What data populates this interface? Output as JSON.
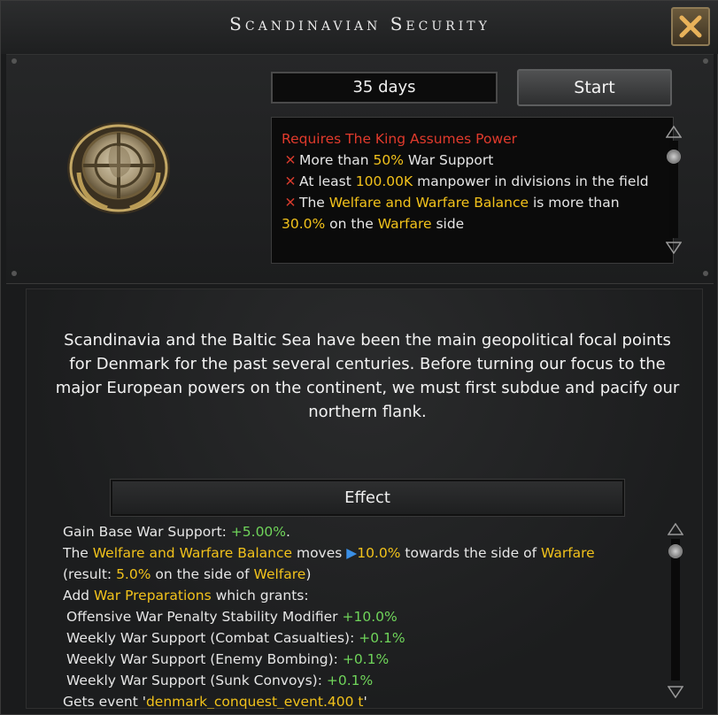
{
  "window": {
    "title": "Scandinavian Security",
    "close_icon": "close-x-icon"
  },
  "focus": {
    "icon": "crosshair-emblem-icon",
    "duration": "35 days",
    "start_label": "Start"
  },
  "requirements": {
    "header": "Requires The King Assumes Power",
    "lines": [
      {
        "pre": "More than ",
        "hl": "50%",
        "post": " War Support"
      },
      {
        "pre": "At least ",
        "hl": "100.00K",
        "post": " manpower in divisions in the field"
      },
      {
        "pre": "The ",
        "hl": "Welfare and Warfare Balance",
        "post": " is more than ",
        "hl2": "30.0%",
        "post2": " on the ",
        "hl3": "Warfare",
        "post3": " side"
      }
    ]
  },
  "description": "Scandinavia and the Baltic Sea have been the main geopolitical focal points for Denmark for the past several centuries. Before turning our focus to the major European powers on the continent, we must first subdue and pacify our northern flank.",
  "effect": {
    "header": "Effect",
    "line1_pre": "Gain Base War Support: ",
    "line1_val": "+5.00%",
    "line1_post": ".",
    "line2_pre": "The ",
    "line2_hl": "Welfare and Warfare Balance",
    "line2_mid": " moves ",
    "line2_val": "10.0%",
    "line2_mid2": " towards the side of ",
    "line2_side": "Warfare",
    "line3_pre": "(result: ",
    "line3_val": "5.0%",
    "line3_mid": " on the side of ",
    "line3_side": "Welfare",
    "line3_post": ")",
    "line4_pre": "Add ",
    "line4_hl": "War Preparations",
    "line4_post": " which grants:",
    "modifiers": [
      {
        "label": "Offensive War Penalty Stability Modifier ",
        "value": "+10.0%"
      },
      {
        "label": "Weekly War Support (Combat Casualties): ",
        "value": "+0.1%"
      },
      {
        "label": "Weekly War Support (Enemy Bombing): ",
        "value": "+0.1%"
      },
      {
        "label": "Weekly War Support (Sunk Convoys): ",
        "value": "+0.1%"
      }
    ],
    "last_pre": "Gets event '",
    "last_hl": "denmark_conquest_event.400 t",
    "last_post": "'"
  }
}
